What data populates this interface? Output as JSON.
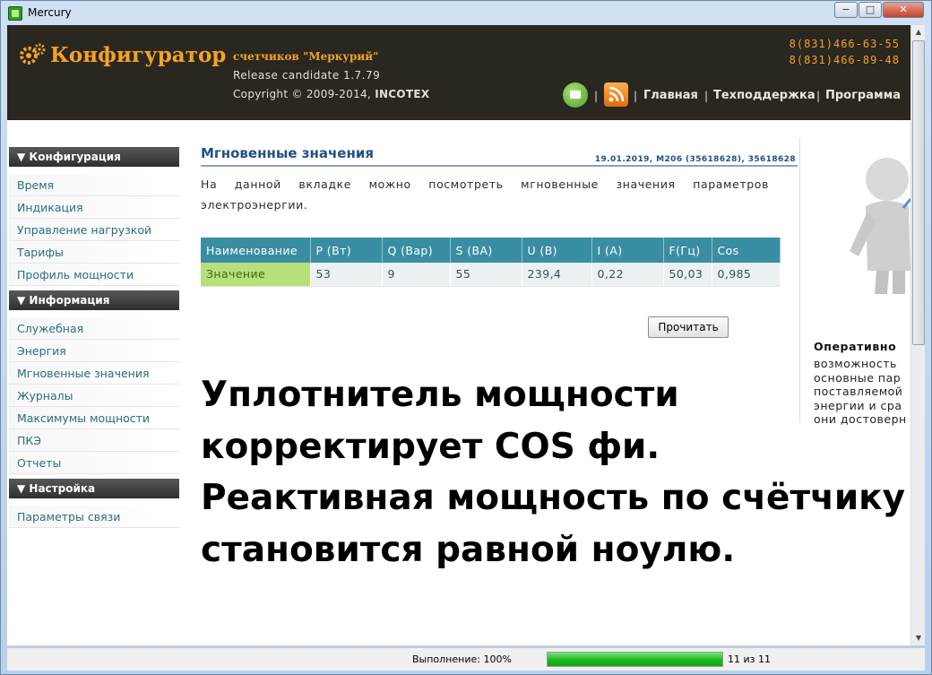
{
  "window": {
    "title": "Mercury",
    "min": "−",
    "max": "□",
    "close": "✕"
  },
  "header": {
    "brand": "Конфигуратор",
    "subtitle": "счетчиков \"Меркурий\"",
    "release": "Release candidate 1.7.79",
    "copyright_prefix": "Copyright © 2009-2014, ",
    "copyright_company": "INCOTEX",
    "phone1": "8(831)466-63-55",
    "phone2": "8(831)466-89-48",
    "separator": "|",
    "nav": [
      "Главная",
      "Техподдержка",
      "Программа"
    ]
  },
  "sidebar": {
    "sections": [
      {
        "title": "▼ Конфигурация",
        "items": [
          "Время",
          "Индикация",
          "Управление нагрузкой",
          "Тарифы",
          "Профиль мощности"
        ]
      },
      {
        "title": "▼ Информация",
        "items": [
          "Служебная",
          "Энергия",
          "Мгновенные значения",
          "Журналы",
          "Максимумы мощности",
          "ПКЭ",
          "Отчеты"
        ]
      },
      {
        "title": "▼ Настройка",
        "items": [
          "Параметры связи"
        ]
      }
    ]
  },
  "main": {
    "title": "Мгновенные значения",
    "meta": "19.01.2019, M206 (35618628), 35618628",
    "description": "На данной вкладке можно посмотреть мгновенные значения параметров электроэнергии.",
    "table": {
      "headers": [
        "Наименование",
        "P (Вт)",
        "Q (Вар)",
        "S (ВА)",
        "U (В)",
        "I (А)",
        "F(Гц)",
        "Cos"
      ],
      "row": [
        "Значение",
        "53",
        "9",
        "55",
        "239,4",
        "0,22",
        "50,03",
        "0,985"
      ]
    },
    "read_button": "Прочитать"
  },
  "side_note": {
    "title": "Оперативно",
    "lines": [
      "возможность",
      "основные пар",
      "поставляемой",
      "энергии и сра",
      "они достоверн"
    ]
  },
  "overlay": {
    "lines": [
      "Уплотнитель мощности",
      "корректирует COS фи.",
      "Реактивная мощность по счётчику",
      "становится равной ноулю."
    ]
  },
  "status": {
    "label": "Выполнение: 100%",
    "progress": 1.0,
    "count": "11 из 11"
  },
  "colors": {
    "accent": "#f2a325",
    "header_bg": "#2a2620",
    "table_head": "#3a8ea3",
    "link": "#2a6e80",
    "progress": "#1bb91b"
  }
}
